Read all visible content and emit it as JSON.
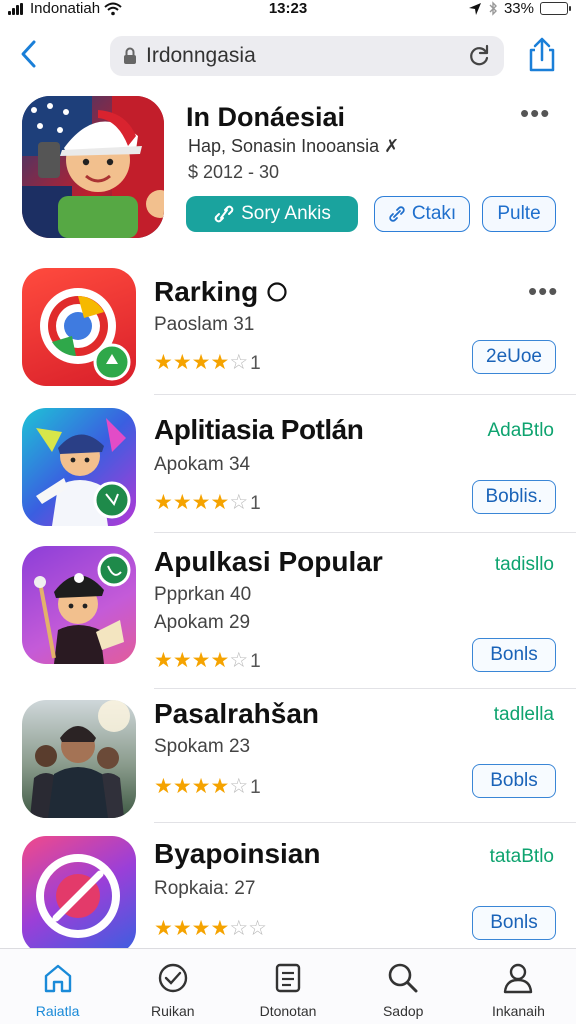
{
  "status_bar": {
    "carrier": "Indonatiah",
    "time": "13:23",
    "battery": "33%",
    "battery_level": 0.33
  },
  "nav": {
    "url": "Irdonngasia"
  },
  "featured": {
    "title": "In Donáesiai",
    "subtitle": "Hap, Sonasin Inooansia ✗",
    "price": "$ 2012 - 30",
    "primary_button": "Sory Ankis",
    "secondary_button": "Ctakı",
    "third_button": "Pulte"
  },
  "apps": [
    {
      "title": "Rarking",
      "lines": [
        "Paoslam 31"
      ],
      "rating": 4,
      "rating_count": "1",
      "tag": "",
      "button": "2eUoe",
      "icon": "chrome-like-icon"
    },
    {
      "title": "Aplitiasia Potlán",
      "lines": [
        "Apokam 34"
      ],
      "rating": 4,
      "rating_count": "1",
      "tag": "AdaBtlo",
      "button": "Boblis.",
      "icon": "cartoon-icon"
    },
    {
      "title": "Apulkasi Popular",
      "lines": [
        "Ppprkan 40",
        "Apokam 29"
      ],
      "rating": 4,
      "rating_count": "1",
      "tag": "tadisllo",
      "button": "Bonls",
      "icon": "cartoon-hat-icon"
    },
    {
      "title": "Pasalrahšan",
      "lines": [
        "Spokam 23"
      ],
      "rating": 4,
      "rating_count": "1",
      "tag": "tadlella",
      "button": "Bobls",
      "icon": "photo-icon"
    },
    {
      "title": "Byapoinsian",
      "lines": [
        "Ropkaia: 27"
      ],
      "rating": 4,
      "rating_count": "",
      "tag": "tataBtlo",
      "button": "Bonls",
      "icon": "compass-icon"
    }
  ],
  "tabs": [
    {
      "label": "Raiatla",
      "icon": "home-icon",
      "active": true
    },
    {
      "label": "Ruikan",
      "icon": "compass-icon",
      "active": false
    },
    {
      "label": "Dtonotan",
      "icon": "list-icon",
      "active": false
    },
    {
      "label": "Sadop",
      "icon": "search-icon",
      "active": false
    },
    {
      "label": "Inkanaih",
      "icon": "profile-icon",
      "active": false
    }
  ],
  "colors": {
    "accent": "#1a8ad8",
    "primary_pill": "#1aa39e",
    "star": "#f5a300",
    "tag_green": "#0ea36f"
  }
}
